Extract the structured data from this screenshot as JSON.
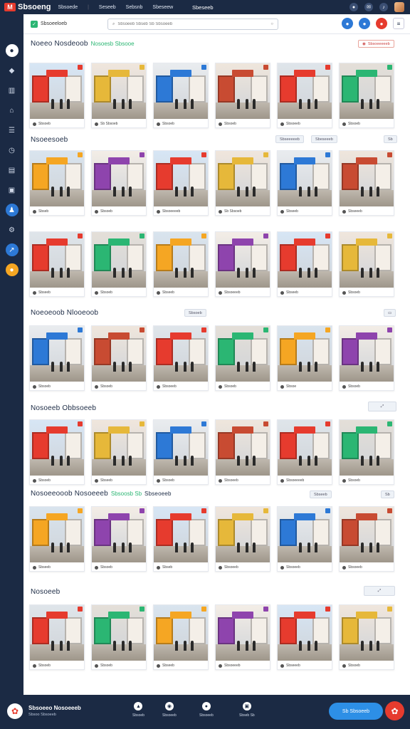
{
  "topbar": {
    "logo_text": "Sbsoeng",
    "nav": [
      "Sbsoede",
      "Seseeb",
      "Sebsnb",
      "Sbeseew"
    ],
    "center_text": "Sbeseeb",
    "icons": [
      "user-icon",
      "message-icon",
      "bell-icon"
    ]
  },
  "sidebar": {
    "items": [
      "home-icon",
      "tag-icon",
      "grid-icon",
      "store-icon",
      "list-icon",
      "clock-icon",
      "chart-icon",
      "cart-icon",
      "people-icon",
      "settings-icon",
      "trend-icon",
      "help-icon"
    ]
  },
  "toolbar": {
    "app_label": "Sbsoeeloeb",
    "search_placeholder": "Sbsoeeb Sbseb Sb Sbsoeeb"
  },
  "sections": [
    {
      "title": "Noeeo Nosdeoob",
      "subtitle": "Nosoesb Sbsooe",
      "chip": "Sbsoeeeeeb"
    },
    {
      "title": "Nsoeesoeb",
      "chips": [
        "Sbseeeeeb",
        "Sbeseeeb",
        "Sb"
      ]
    },
    {
      "title": "Noeoeoob Nlooeoob",
      "chip": "Sbsoeb"
    },
    {
      "title": "Nosoeeb Obbsoeeb",
      "chip": "Sb"
    },
    {
      "title": "Nosoeeooob Nosoeeeb",
      "subtitle": "Sbsoosb Sb",
      "tail": "Sbseoeeb",
      "chips": [
        "Sbseeb",
        "Sb"
      ]
    },
    {
      "title": "Nosoeeb",
      "chip": "Sb"
    }
  ],
  "captions": [
    "Sbsoeb",
    "Sb Sbsoeb",
    "Sbsoeb",
    "Sbsoeb",
    "Sbsoeeb",
    "Sbsoeb",
    "Sbseb",
    "Sbsoeb",
    "Sbsoeeeeb",
    "Sb Sbsoeb",
    "Sbseeb",
    "Sbseeeb",
    "Sbseeb",
    "Sbsoeb",
    "Sbseeb",
    "Sbsoeeeb",
    "Sbseeb",
    "Sbsoeb",
    "Sbsoeb",
    "Sbsoeb",
    "Sbsoeeb",
    "Sbsoeb",
    "Sbsoe",
    "Sbsoeb",
    "Sbsoeb",
    "Sbseeb",
    "Sbsoeb",
    "Sbsoeeb",
    "Sbsoeeeeb",
    "Sbsoeb",
    "Sbseeb",
    "Sbsoeb",
    "Sbseb",
    "Sbsoeeb",
    "Sbsoeeb",
    "Sbsoeeb",
    "Sbsoeb",
    "Sbsoeb",
    "Sbseeb",
    "Sbsoeeeb",
    "Sbseeeb",
    "Sbsoeb"
  ],
  "bottombar": {
    "title": "Sbsoeeo Nosoeeeb",
    "subtitle": "Sbsoo Sbsoeeb",
    "nav": [
      "Sbsoeb",
      "Sbsoeeb",
      "Sbsoeeb",
      "Sbseb Sb"
    ],
    "cta": "Sb Sbsoeeb"
  },
  "colors": {
    "brand_red": "#e63b2e",
    "navy": "#1b2a44",
    "accent_blue": "#2d79d6",
    "accent_green": "#2bb673"
  }
}
